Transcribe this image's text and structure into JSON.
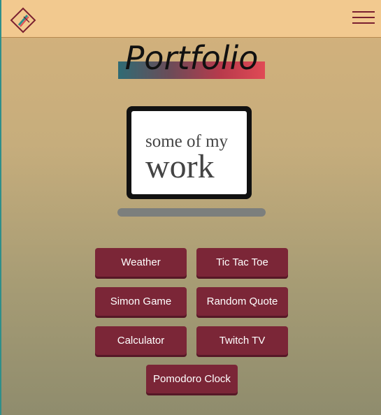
{
  "header": {
    "logo_icon": "pencil-logo-icon",
    "menu_icon": "hamburger-menu-icon"
  },
  "main": {
    "title": "Portfolio",
    "laptop": {
      "line1": "some of my",
      "line2": "work"
    },
    "projects": [
      {
        "label": "Weather"
      },
      {
        "label": "Tic Tac Toe"
      },
      {
        "label": "Simon Game"
      },
      {
        "label": "Random Quote"
      },
      {
        "label": "Calculator"
      },
      {
        "label": "Twitch TV"
      },
      {
        "label": "Pomodoro Clock"
      }
    ]
  },
  "colors": {
    "navbar": "#f2c98f",
    "button": "#7b2637",
    "accent_dark": "#7a2030"
  }
}
